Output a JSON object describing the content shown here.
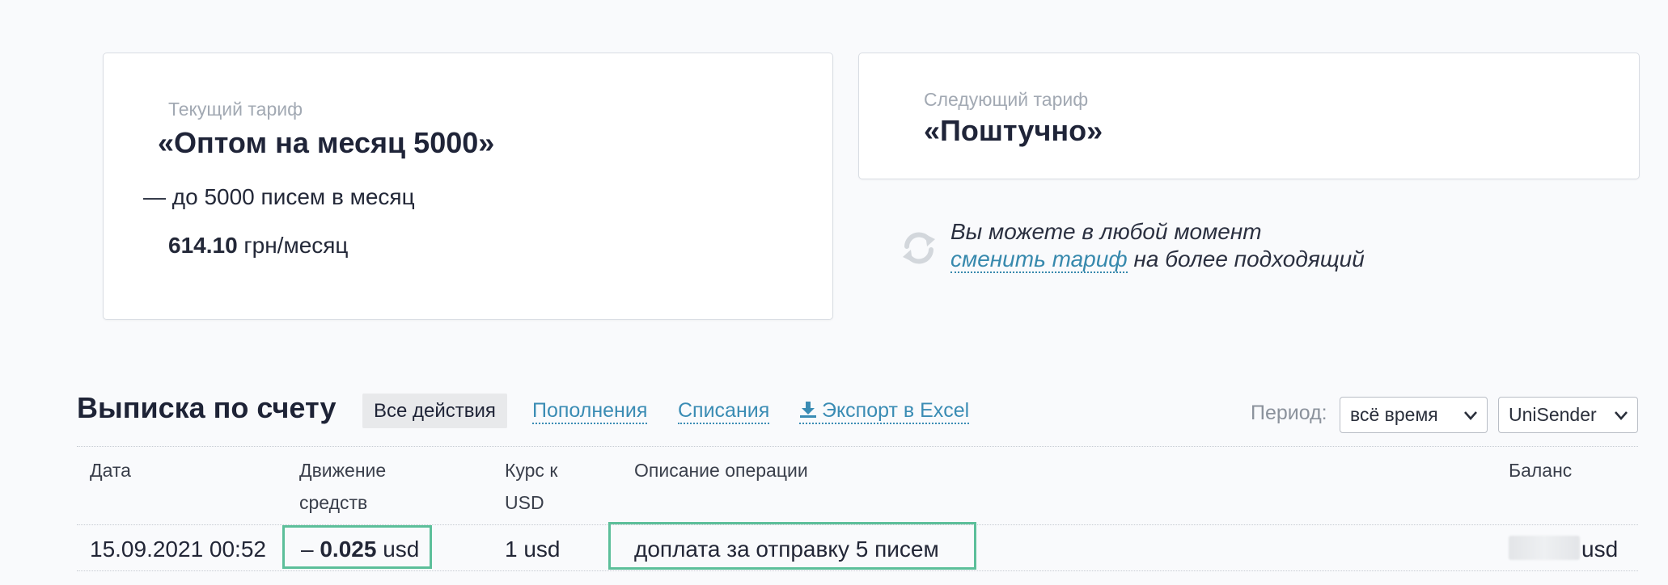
{
  "current_tariff": {
    "caption": "Текущий тариф",
    "name": "«Оптом на месяц 5000»",
    "limit": "— до 5000 писем в месяц",
    "price_value": "614.10",
    "price_unit": "грн/месяц"
  },
  "next_tariff": {
    "caption": "Следующий тариф",
    "name": "«Поштучно»"
  },
  "hint": {
    "line1": "Вы можете в любой момент",
    "link": "сменить тариф",
    "line2_rest": " на более подходящий",
    "icon": "refresh-icon"
  },
  "statement": {
    "title": "Выписка по счету",
    "filters": {
      "all": "Все действия",
      "deposits": "Пополнения",
      "charges": "Списания",
      "export": "Экспорт в Excel"
    },
    "period_label": "Период:",
    "period_selected": "всё время",
    "account_selected": "UniSender",
    "columns": {
      "date": "Дата",
      "movement_line1": "Движение",
      "movement_line2": "средств",
      "rate_line1": "Курс к",
      "rate_line2": "USD",
      "description": "Описание операции",
      "balance": "Баланс"
    },
    "rows": [
      {
        "date": "15.09.2021 00:52",
        "movement_sign": "– ",
        "movement_amount": "0.025",
        "movement_unit": " usd",
        "rate": "1 usd",
        "description": "доплата за отправку 5 писем",
        "balance_unit": "usd"
      }
    ]
  },
  "colors": {
    "accent_link": "#3a8cb4",
    "highlight": "#5cbf9a",
    "background": "#f9fafc"
  }
}
